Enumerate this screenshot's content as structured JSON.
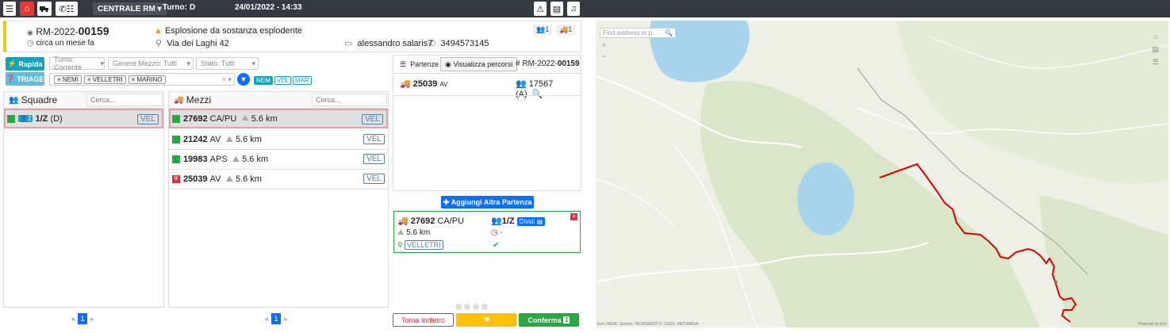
{
  "topbar": {
    "centrale": "CENTRALE RM",
    "turno_label": "Turno:",
    "turno_value": "D",
    "datetime": "24/01/2022 - 14:33"
  },
  "call": {
    "code_prefix": "RM-2022-",
    "code_number": "00159",
    "time_ago": "circa un mese fa",
    "type": "Esplosione da sostanza esplodente",
    "address": "Via dei Laghi 42",
    "caller": "alessandro salaris7",
    "phone": "3494573145",
    "count_people": "1",
    "count_vehicles": "1"
  },
  "filters": {
    "rapida_label": "Rapida",
    "triage_label": "TRIAGE",
    "turno_placeholder": "Turno: Corrente",
    "genere_placeholder": "Genere Mezzo: Tutti",
    "stato_placeholder": "Stato: Tutti",
    "selected_tags": [
      "NEMI",
      "VELLETRI",
      "MARINO"
    ],
    "distaccamenti": [
      "NEM",
      "VEL",
      "MAR"
    ]
  },
  "squadre": {
    "title": "Squadre",
    "search_placeholder": "Cerca...",
    "items": [
      {
        "count": "2",
        "name": "1/Z",
        "turno": "(D)",
        "sede": "VEL"
      }
    ]
  },
  "mezzi": {
    "title": "Mezzi",
    "search_placeholder": "Cerca...",
    "items": [
      {
        "code": "27692",
        "genere": "CA/PU",
        "distance": "5.6 km",
        "sede": "VEL",
        "status": "green"
      },
      {
        "code": "21242",
        "genere": "AV",
        "distance": "5.6 km",
        "sede": "VEL",
        "status": "green"
      },
      {
        "code": "19983",
        "genere": "APS",
        "distance": "5.6 km",
        "sede": "VEL",
        "status": "green"
      },
      {
        "code": "25039",
        "genere": "AV",
        "distance": "5.6 km",
        "sede": "VEL",
        "status": "red",
        "status_letter": "V"
      }
    ]
  },
  "partenze": {
    "tab_label": "Partenze",
    "percorsi_label": "Visualizza percorsi",
    "code_prefix": "RM-2022-",
    "code_number": "00159",
    "vehicle_code": "25039",
    "vehicle_genere": "AV",
    "team_code": "17567 (A)",
    "add_label": "Aggiungi Altra Partenza"
  },
  "composition": {
    "vehicle_code": "27692",
    "vehicle_genere": "CA/PU",
    "distance": "5.6 km",
    "sede": "VELLETRI",
    "team_name": "1/Z",
    "dividi_label": "Dividi",
    "time_value": "-"
  },
  "actions": {
    "back_label": "Torna Indietro",
    "confirm_label": "Conferma",
    "confirm_count": "1"
  },
  "pagination": {
    "page": "1"
  },
  "map": {
    "search_placeholder": "Find address or p",
    "attribution_left": "Esri, HERE, Garmin, INCREMENT P, USGS, METI/NASA",
    "attribution_right": "Powered by Esri"
  }
}
